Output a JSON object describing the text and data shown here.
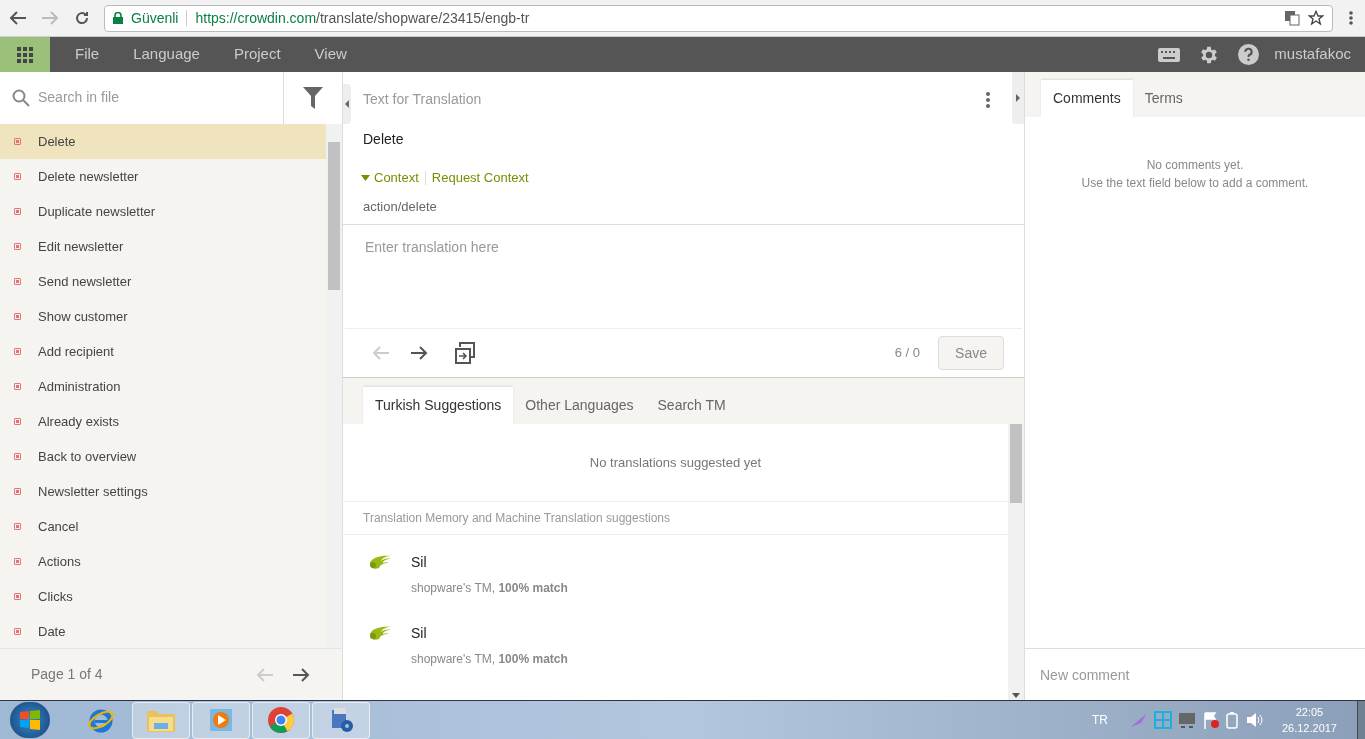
{
  "browser": {
    "secure_label": "Güvenli",
    "url_host": "https://crowdin.com",
    "url_path": "/translate/shopware/23415/engb-tr"
  },
  "menu": [
    "File",
    "Language",
    "Project",
    "View"
  ],
  "user": "mustafakoc",
  "search": {
    "placeholder": "Search in file"
  },
  "strings": [
    {
      "text": "Delete",
      "selected": true,
      "translated": false
    },
    {
      "text": "Delete newsletter",
      "selected": false,
      "translated": false
    },
    {
      "text": "Duplicate newsletter",
      "selected": false,
      "translated": false
    },
    {
      "text": "Edit newsletter",
      "selected": false,
      "translated": false
    },
    {
      "text": "Send newsletter",
      "selected": false,
      "translated": false
    },
    {
      "text": "Show customer",
      "selected": false,
      "translated": false
    },
    {
      "text": "Add recipient",
      "selected": false,
      "translated": false
    },
    {
      "text": "Administration",
      "selected": false,
      "translated": false
    },
    {
      "text": "Already exists",
      "selected": false,
      "translated": false
    },
    {
      "text": "Back to overview",
      "selected": false,
      "translated": false
    },
    {
      "text": "Newsletter settings",
      "selected": false,
      "translated": false
    },
    {
      "text": "Cancel",
      "selected": false,
      "translated": false
    },
    {
      "text": "Actions",
      "selected": false,
      "translated": false
    },
    {
      "text": "Clicks",
      "selected": false,
      "translated": false
    },
    {
      "text": "Date",
      "selected": false,
      "translated": false
    }
  ],
  "pager": {
    "label": "Page 1 of 4",
    "prev_disabled": true,
    "next_disabled": false
  },
  "source": {
    "heading": "Text for Translation",
    "text": "Delete",
    "context_toggle": "Context",
    "context_expanded": true,
    "request_context": "Request Context",
    "context": "action/delete"
  },
  "translation": {
    "placeholder": "Enter translation here",
    "prev_disabled": true,
    "next_disabled": false,
    "counter": "6 / 0",
    "save": "Save"
  },
  "suggestion_tabs": [
    {
      "label": "Turkish Suggestions",
      "selected": true
    },
    {
      "label": "Other Languages",
      "selected": false
    },
    {
      "label": "Search TM",
      "selected": false
    }
  ],
  "no_suggestions": "No translations suggested yet",
  "tm_heading": "Translation Memory and Machine Translation suggestions",
  "suggestions": [
    {
      "text": "Sil",
      "source": "shopware's TM, **100% match**"
    },
    {
      "text": "Sil",
      "source": "shopware's TM, **100% match**"
    }
  ],
  "side_tabs": [
    {
      "label": "Comments",
      "selected": true
    },
    {
      "label": "Terms",
      "selected": false
    }
  ],
  "no_comments": [
    "No comments yet.",
    "Use the text field below to add a comment."
  ],
  "comment": {
    "placeholder": "New comment"
  },
  "taskbar": {
    "apps": [
      {
        "kind": "ie",
        "active": false
      },
      {
        "kind": "folder",
        "active": true
      },
      {
        "kind": "media",
        "active": true
      },
      {
        "kind": "chrome",
        "active": true
      },
      {
        "kind": "installer",
        "active": true
      }
    ],
    "language": "TR",
    "time": "22:05",
    "date": "26.12.2017"
  }
}
